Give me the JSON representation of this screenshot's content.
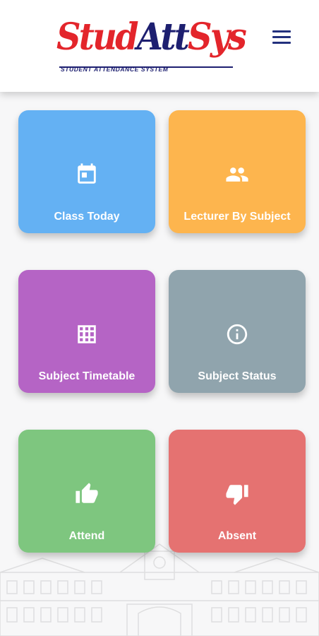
{
  "header": {
    "logo": {
      "part1": "Stud",
      "part2": "Att",
      "part3": "Sys",
      "tagline": "STUDENT ATTENDANCE SYSTEM"
    },
    "menu_icon": "hamburger-menu-icon"
  },
  "colors": {
    "blue": "#64b1f3",
    "orange": "#fdb54e",
    "purple": "#b564c5",
    "grey": "#90a4ad",
    "green": "#7ec67f",
    "red": "#e57271",
    "logo_red": "#e3252b",
    "logo_navy": "#1d1f70"
  },
  "tiles": [
    {
      "label": "Class Today",
      "icon": "calendar-icon"
    },
    {
      "label": "Lecturer By Subject",
      "icon": "people-icon"
    },
    {
      "label": "Subject Timetable",
      "icon": "grid-icon"
    },
    {
      "label": "Subject Status",
      "icon": "info-icon"
    },
    {
      "label": "Attend",
      "icon": "thumbs-up-icon"
    },
    {
      "label": "Absent",
      "icon": "thumbs-down-icon"
    }
  ]
}
